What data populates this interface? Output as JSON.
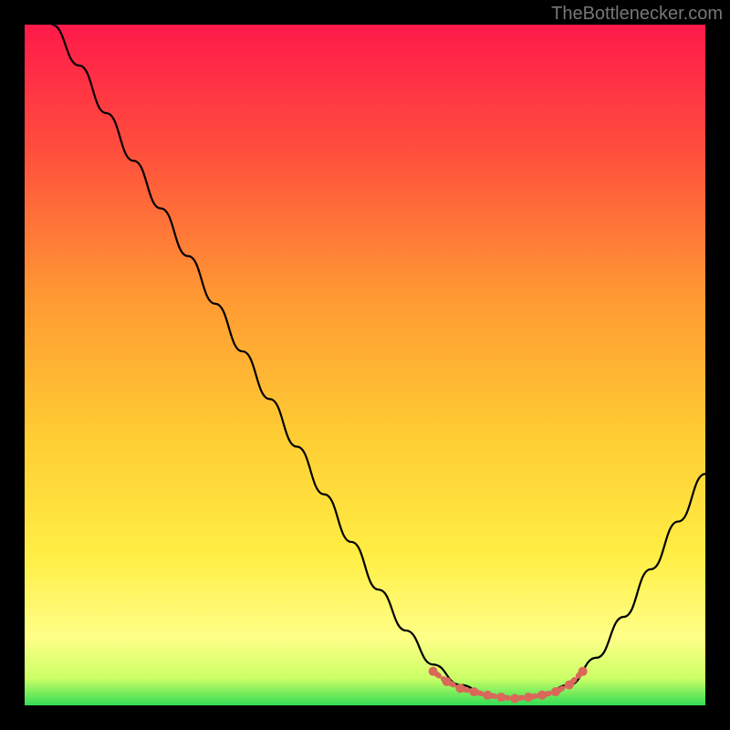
{
  "watermark": "TheBottlenecker.com",
  "chart_data": {
    "type": "line",
    "title": "",
    "xlabel": "",
    "ylabel": "",
    "xlim": [
      0,
      100
    ],
    "ylim": [
      0,
      100
    ],
    "series": [
      {
        "name": "curve",
        "color": "#000000",
        "points": [
          {
            "x": 4,
            "y": 100
          },
          {
            "x": 8,
            "y": 94
          },
          {
            "x": 12,
            "y": 87
          },
          {
            "x": 16,
            "y": 80
          },
          {
            "x": 20,
            "y": 73
          },
          {
            "x": 24,
            "y": 66
          },
          {
            "x": 28,
            "y": 59
          },
          {
            "x": 32,
            "y": 52
          },
          {
            "x": 36,
            "y": 45
          },
          {
            "x": 40,
            "y": 38
          },
          {
            "x": 44,
            "y": 31
          },
          {
            "x": 48,
            "y": 24
          },
          {
            "x": 52,
            "y": 17
          },
          {
            "x": 56,
            "y": 11
          },
          {
            "x": 60,
            "y": 6
          },
          {
            "x": 64,
            "y": 3
          },
          {
            "x": 68,
            "y": 1.5
          },
          {
            "x": 72,
            "y": 1
          },
          {
            "x": 76,
            "y": 1.5
          },
          {
            "x": 80,
            "y": 3
          },
          {
            "x": 84,
            "y": 7
          },
          {
            "x": 88,
            "y": 13
          },
          {
            "x": 92,
            "y": 20
          },
          {
            "x": 96,
            "y": 27
          },
          {
            "x": 100,
            "y": 34
          }
        ]
      },
      {
        "name": "bottom_markers",
        "color": "#d9685a",
        "points": [
          {
            "x": 60,
            "y": 5
          },
          {
            "x": 62,
            "y": 3.5
          },
          {
            "x": 64,
            "y": 2.5
          },
          {
            "x": 66,
            "y": 2
          },
          {
            "x": 68,
            "y": 1.5
          },
          {
            "x": 70,
            "y": 1.2
          },
          {
            "x": 72,
            "y": 1
          },
          {
            "x": 74,
            "y": 1.2
          },
          {
            "x": 76,
            "y": 1.5
          },
          {
            "x": 78,
            "y": 2
          },
          {
            "x": 80,
            "y": 3
          },
          {
            "x": 82,
            "y": 5
          }
        ]
      }
    ],
    "gradient_stops": [
      {
        "offset": 0,
        "color": "#ff1a4a"
      },
      {
        "offset": 18,
        "color": "#ff4d3d"
      },
      {
        "offset": 40,
        "color": "#ff9933"
      },
      {
        "offset": 60,
        "color": "#ffcc33"
      },
      {
        "offset": 78,
        "color": "#ffee44"
      },
      {
        "offset": 90,
        "color": "#ffff88"
      },
      {
        "offset": 96,
        "color": "#ccff66"
      },
      {
        "offset": 100,
        "color": "#33dd55"
      }
    ]
  }
}
